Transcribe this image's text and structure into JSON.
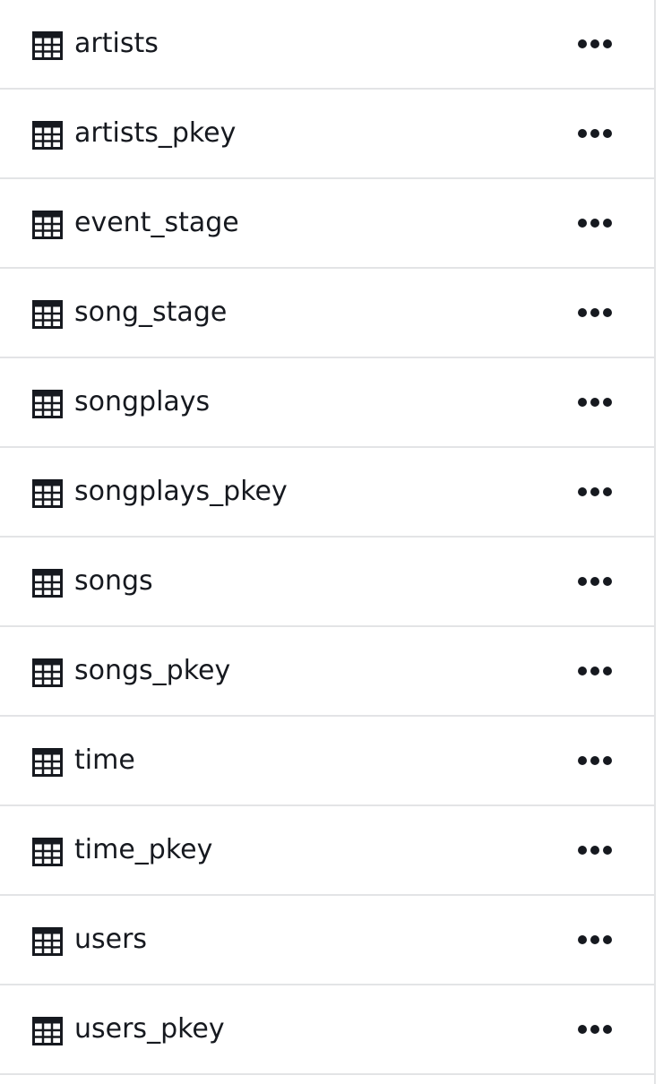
{
  "table_list": {
    "items": [
      {
        "label": "artists",
        "icon": "table-icon",
        "menu_icon": "more-options-icon"
      },
      {
        "label": "artists_pkey",
        "icon": "table-icon",
        "menu_icon": "more-options-icon"
      },
      {
        "label": "event_stage",
        "icon": "table-icon",
        "menu_icon": "more-options-icon"
      },
      {
        "label": "song_stage",
        "icon": "table-icon",
        "menu_icon": "more-options-icon"
      },
      {
        "label": "songplays",
        "icon": "table-icon",
        "menu_icon": "more-options-icon"
      },
      {
        "label": "songplays_pkey",
        "icon": "table-icon",
        "menu_icon": "more-options-icon"
      },
      {
        "label": "songs",
        "icon": "table-icon",
        "menu_icon": "more-options-icon"
      },
      {
        "label": "songs_pkey",
        "icon": "table-icon",
        "menu_icon": "more-options-icon"
      },
      {
        "label": "time",
        "icon": "table-icon",
        "menu_icon": "more-options-icon"
      },
      {
        "label": "time_pkey",
        "icon": "table-icon",
        "menu_icon": "more-options-icon"
      },
      {
        "label": "users",
        "icon": "table-icon",
        "menu_icon": "more-options-icon"
      },
      {
        "label": "users_pkey",
        "icon": "table-icon",
        "menu_icon": "more-options-icon"
      }
    ]
  },
  "colors": {
    "text": "#16191f",
    "divider": "#e3e4e6",
    "background": "#ffffff"
  }
}
